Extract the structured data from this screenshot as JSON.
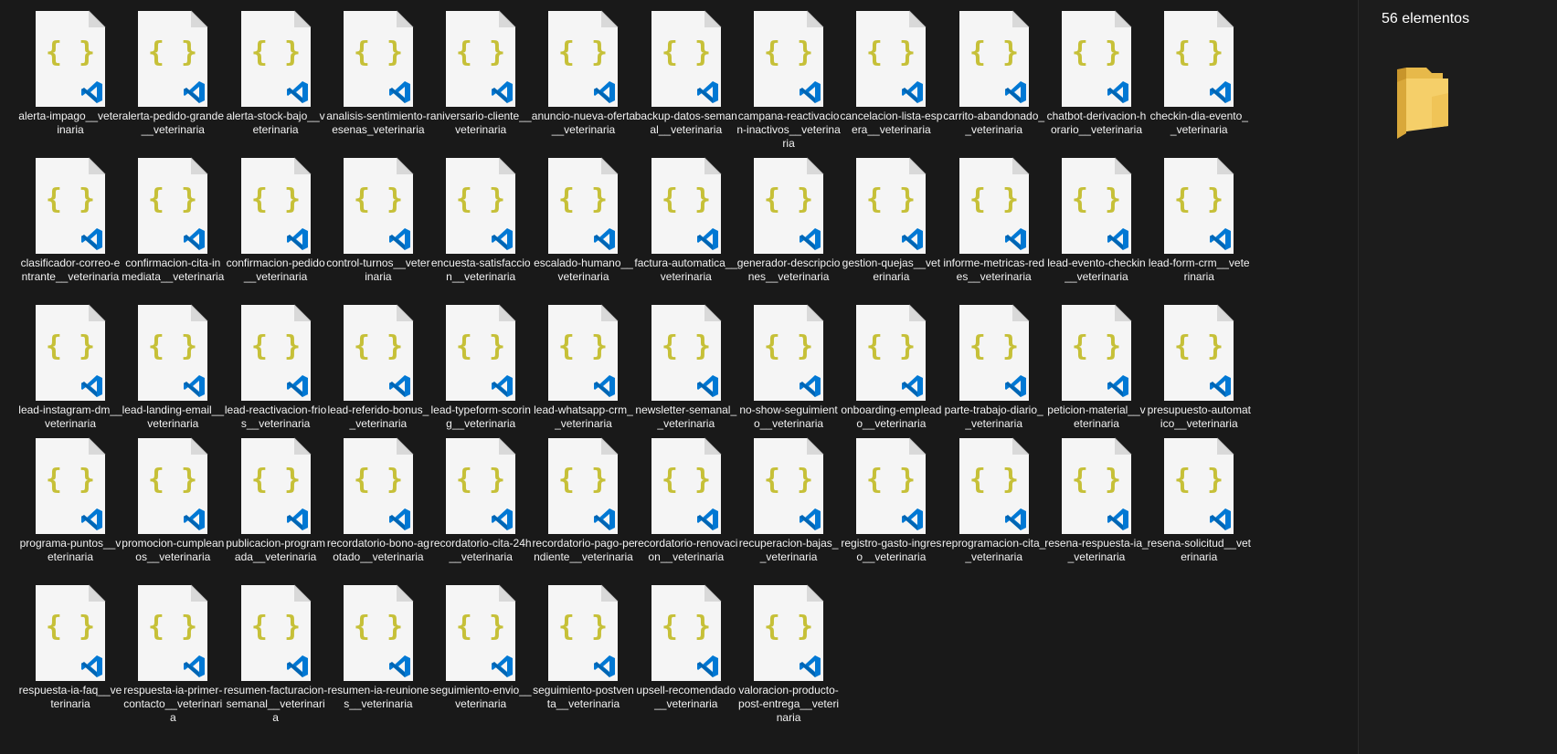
{
  "details": {
    "item_count": "56 elementos"
  },
  "icons": {
    "file": "json-vscode-file-icon",
    "preview": "folder-icon"
  },
  "colors": {
    "background": "#191919",
    "braces": "#c6c038",
    "vscode_blue": "#0078d4",
    "label_text": "#f2f2f2"
  },
  "rows": [
    [
      "alerta-impago__veterinaria",
      "alerta-pedido-grande__veterinaria",
      "alerta-stock-bajo__veterinaria",
      "analisis-sentimiento-resenas_veterinaria",
      "aniversario-cliente__veterinaria",
      "anuncio-nueva-oferta__veterinaria",
      "backup-datos-semanal__veterinaria",
      "campana-reactivacion-inactivos__veterinaria",
      "cancelacion-lista-espera__veterinaria",
      "carrito-abandonado__veterinaria",
      "chatbot-derivacion-horario__veterinaria",
      "checkin-dia-evento__veterinaria"
    ],
    [
      "clasificador-correo-entrante__veterinaria",
      "confirmacion-cita-inmediata__veterinaria",
      "confirmacion-pedido__veterinaria",
      "control-turnos__veterinaria",
      "encuesta-satisfaccion__veterinaria",
      "escalado-humano__veterinaria",
      "factura-automatica__veterinaria",
      "generador-descripciones__veterinaria",
      "gestion-quejas__veterinaria",
      "informe-metricas-redes__veterinaria",
      "lead-evento-checkin__veterinaria",
      "lead-form-crm__veterinaria"
    ],
    [
      "lead-instagram-dm__veterinaria",
      "lead-landing-email__veterinaria",
      "lead-reactivacion-frios__veterinaria",
      "lead-referido-bonus__veterinaria",
      "lead-typeform-scoring__veterinaria",
      "lead-whatsapp-crm__veterinaria",
      "newsletter-semanal__veterinaria",
      "no-show-seguimiento__veterinaria",
      "onboarding-empleado__veterinaria",
      "parte-trabajo-diario__veterinaria",
      "peticion-material__veterinaria",
      "presupuesto-automatico__veterinaria"
    ],
    [
      "programa-puntos__veterinaria",
      "promocion-cumpleanos__veterinaria",
      "publicacion-programada__veterinaria",
      "recordatorio-bono-agotado__veterinaria",
      "recordatorio-cita-24h__veterinaria",
      "recordatorio-pago-pendiente__veterinaria",
      "recordatorio-renovacion__veterinaria",
      "recuperacion-bajas__veterinaria",
      "registro-gasto-ingreso__veterinaria",
      "reprogramacion-cita__veterinaria",
      "resena-respuesta-ia__veterinaria",
      "resena-solicitud__veterinaria"
    ],
    [
      "respuesta-ia-faq__veterinaria",
      "respuesta-ia-primer-contacto__veterinaria",
      "resumen-facturacion-semanal__veterinaria",
      "resumen-ia-reuniones__veterinaria",
      "seguimiento-envio__veterinaria",
      "seguimiento-postventa__veterinaria",
      "upsell-recomendado__veterinaria",
      "valoracion-producto-post-entrega__veterinaria"
    ]
  ]
}
